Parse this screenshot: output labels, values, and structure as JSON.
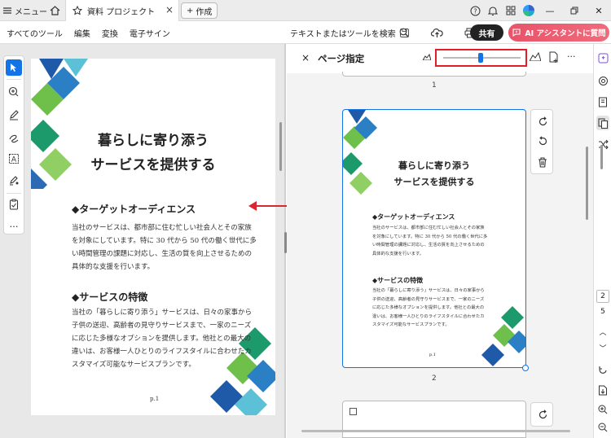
{
  "titlebar": {
    "menu_label": "メニュー",
    "tab_title": "資料 プロジェクト",
    "new_label": "作成"
  },
  "toolbar": {
    "items": [
      "すべてのツール",
      "編集",
      "変換",
      "電子サイン"
    ],
    "search_label": "テキストまたはツールを検索",
    "share_label": "共有",
    "ai_label": "AI アシスタントに質問"
  },
  "document": {
    "title_line1": "暮らしに寄り添う",
    "title_line2": "サービスを提供する",
    "section1_heading": "◆ターゲットオーディエンス",
    "section1_lines": [
      "当社のサービスは、都市部に住む忙しい社会人とその家族",
      "を対象にしています。特に 30 代から 50 代の働く世代に多",
      "い時間管理の課題に対応し、生活の質を向上させるための",
      "具体的な支援を行います。"
    ],
    "section2_heading": "◆サービスの特徴",
    "section2_lines": [
      "当社の「暮らしに寄り添う」サービスは、日々の家事から",
      "子供の送迎、高齢者の見守りサービスまで、一家のニーズ",
      "に応じた多様なオプションを提供します。他社との最大の",
      "違いは、お客様一人ひとりのライフスタイルに合わせたカ",
      "スタマイズ可能なサービスプランです。"
    ],
    "page_label": "p.1"
  },
  "panel": {
    "title": "ページ指定",
    "zoom_level": 0.48,
    "page_numbers": [
      "1",
      "2"
    ],
    "thumb_page_label": "p.1"
  },
  "right_rail": {
    "page_current": "2",
    "page_total": "5"
  },
  "colors": {
    "accent": "#1473e6",
    "highlight": "#e21f26",
    "ai_button": "#ea5a6e"
  }
}
